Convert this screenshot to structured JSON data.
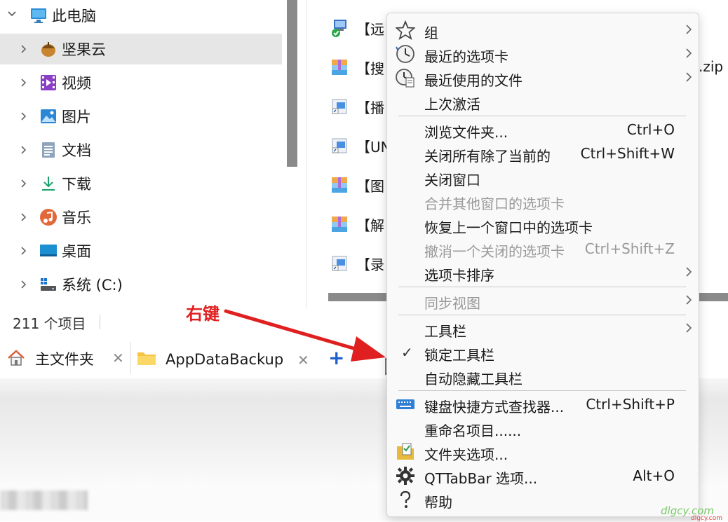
{
  "nav": {
    "root_label": "此电脑",
    "items": [
      {
        "label": "坚果云",
        "icon": "nut-icon"
      },
      {
        "label": "视频",
        "icon": "video-icon"
      },
      {
        "label": "图片",
        "icon": "picture-icon"
      },
      {
        "label": "文档",
        "icon": "document-icon"
      },
      {
        "label": "下载",
        "icon": "download-icon"
      },
      {
        "label": "音乐",
        "icon": "music-icon"
      },
      {
        "label": "桌面",
        "icon": "desktop-icon"
      },
      {
        "label": "系统 (C:)",
        "icon": "drive-icon"
      }
    ]
  },
  "status": {
    "item_count": "211 个项目"
  },
  "files": [
    {
      "label": "【远",
      "icon": "remote-icon"
    },
    {
      "label": "【搜",
      "icon": "archive-icon"
    },
    {
      "label": "【播",
      "icon": "shortcut-icon"
    },
    {
      "label": "【UN",
      "icon": "shortcut-icon"
    },
    {
      "label": "【图",
      "icon": "archive-icon"
    },
    {
      "label": "【解",
      "icon": "archive-icon"
    },
    {
      "label": "【录",
      "icon": "shortcut-icon"
    }
  ],
  "zip_suffix": ".zip",
  "tabs": [
    {
      "label": "主文件夹",
      "close": "✕"
    },
    {
      "label": "AppDataBackup",
      "close": "✕"
    }
  ],
  "add_tab": "+",
  "annotation": {
    "label": "右键",
    "color": "#e02020"
  },
  "menu": {
    "group1": [
      {
        "label": "组",
        "icon": "star-icon",
        "submenu": true
      },
      {
        "label": "最近的选项卡",
        "icon": "clock-icon",
        "submenu": true
      },
      {
        "label": "最近使用的文件",
        "icon": "clock-file-icon",
        "submenu": true
      },
      {
        "label": "上次激活",
        "icon": "",
        "submenu": false
      }
    ],
    "group2": [
      {
        "label": "浏览文件夹...",
        "key": "Ctrl+O",
        "disabled": false
      },
      {
        "label": "关闭所有除了当前的",
        "key": "Ctrl+Shift+W",
        "disabled": false
      },
      {
        "label": "关闭窗口",
        "key": "",
        "disabled": false
      },
      {
        "label": "合并其他窗口的选项卡",
        "key": "",
        "disabled": true
      },
      {
        "label": "恢复上一个窗口中的选项卡",
        "key": "",
        "disabled": false
      },
      {
        "label": "撤消一个关闭的选项卡",
        "key": "Ctrl+Shift+Z",
        "disabled": true
      },
      {
        "label": "选项卡排序",
        "key": "",
        "disabled": false,
        "submenu": true
      }
    ],
    "group3": [
      {
        "label": "同步视图",
        "disabled": true,
        "submenu": true
      }
    ],
    "group4": [
      {
        "label": "工具栏",
        "submenu": true,
        "checked": false
      },
      {
        "label": "锁定工具栏",
        "submenu": false,
        "checked": true
      },
      {
        "label": "自动隐藏工具栏",
        "submenu": false,
        "checked": false
      }
    ],
    "group5": [
      {
        "label": "键盘快捷方式查找器...",
        "key": "Ctrl+Shift+P",
        "icon": "keyboard-icon"
      },
      {
        "label": "重命名项目......",
        "key": "",
        "icon": ""
      },
      {
        "label": "文件夹选项...",
        "key": "",
        "icon": "folder-options-icon"
      },
      {
        "label": "QTTabBar 选项...",
        "key": "Alt+O",
        "icon": "gear-icon"
      },
      {
        "label": "帮助",
        "key": "",
        "icon": "help-icon"
      }
    ],
    "submenu_glyph": "›",
    "check_glyph": "✓"
  },
  "watermark": {
    "main": "dlgcy.com",
    "sub": "dlgcy.com"
  }
}
